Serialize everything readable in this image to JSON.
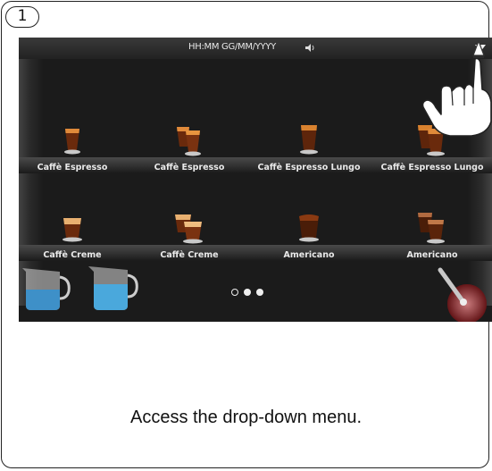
{
  "step": {
    "number": "1"
  },
  "screen": {
    "status": {
      "datetime": "HH:MM GG/MM/YYYY",
      "volume_icon": "speaker-icon"
    },
    "menu_icon": "drop-down-arrow-icon",
    "beverages_row1": [
      {
        "label": "Caffè Espresso",
        "icon": "espresso-cup-icon"
      },
      {
        "label": "Caffè Espresso",
        "icon": "double-espresso-cup-icon"
      },
      {
        "label": "Caffè Espresso Lungo",
        "icon": "espresso-lungo-cup-icon"
      },
      {
        "label": "Caffè Espresso Lungo",
        "icon": "double-espresso-lungo-cup-icon"
      }
    ],
    "beverages_row2": [
      {
        "label": "Caffè Creme",
        "icon": "creme-cup-icon"
      },
      {
        "label": "Caffè Creme",
        "icon": "double-creme-cup-icon"
      },
      {
        "label": "Americano",
        "icon": "americano-cup-icon"
      },
      {
        "label": "Americano",
        "icon": "double-americano-cup-icon"
      }
    ],
    "pager": {
      "pages": 3,
      "current": 1
    },
    "bottom_icons": [
      "milk-jug-icon",
      "hot-water-jug-icon",
      "steam-wand-icon"
    ]
  },
  "caption": "Access the drop-down menu.",
  "colors": {
    "screen_bg": "#1b1b1b",
    "coffee": "#8a3a12",
    "crema": "#e08a3a",
    "water": "#4aa8dc",
    "steam": "#b0282c"
  }
}
